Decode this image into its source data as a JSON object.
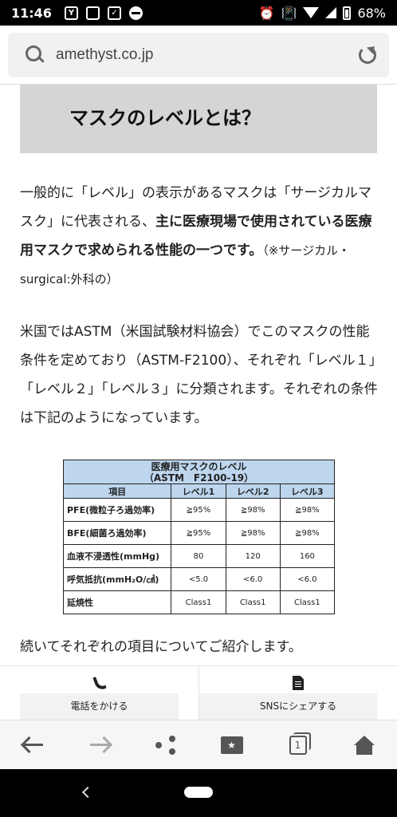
{
  "status_bar": {
    "time": "11:46",
    "icon_badges": [
      "Y",
      "✓"
    ],
    "battery": "68%"
  },
  "browser": {
    "url": "amethyst.co.jp"
  },
  "article": {
    "heading": "マスクのレベルとは？",
    "para1_plain": "一般的に「レベル」の表示があるマスクは「サージカルマスク」に代表される、",
    "para1_bold": "主に医療現場で使用されている医療用マスクで求められる性能の一つです。",
    "para1_paren": "（※サージカル・surgical:外科の）",
    "para2": "米国ではASTM（米国試験材料協会）でこのマスクの性能条件を定めており（ASTM-F2100）、それぞれ「レベル１」「レベル２」「レベル３」に分類されます。それぞれの条件は下記のようになっています。",
    "para3": "続いてそれぞれの項目についてご紹介します。"
  },
  "table": {
    "title_line1": "医療用マスクのレベル",
    "title_line2": "（ASTM　F2100-19）",
    "headers": [
      "項目",
      "レベル1",
      "レベル2",
      "レベル3"
    ],
    "rows": [
      [
        "PFE(微粒子ろ過効率)",
        "≧95%",
        "≧98%",
        "≧98%"
      ],
      [
        "BFE(細菌ろ過効率)",
        "≧95%",
        "≧98%",
        "≧98%"
      ],
      [
        "血液不浸透性(mmHg)",
        "80",
        "120",
        "160"
      ],
      [
        "呼気抵抗(mmH₂O/㎠)",
        "<5.0",
        "<6.0",
        "<6.0"
      ],
      [
        "延焼性",
        "Class1",
        "Class1",
        "Class1"
      ]
    ]
  },
  "share_bar": {
    "call_label": "電話をかける",
    "sns_label": "SNSにシェアする"
  },
  "nav": {
    "tab_count": "1",
    "bookmark_glyph": "★"
  },
  "icons": [
    "search-icon",
    "reload-icon",
    "phone-icon",
    "document-icon",
    "back-arrow-icon",
    "forward-arrow-icon",
    "share-icon",
    "bookmarks-icon",
    "tabs-icon",
    "home-icon",
    "chevron-up-icon"
  ]
}
